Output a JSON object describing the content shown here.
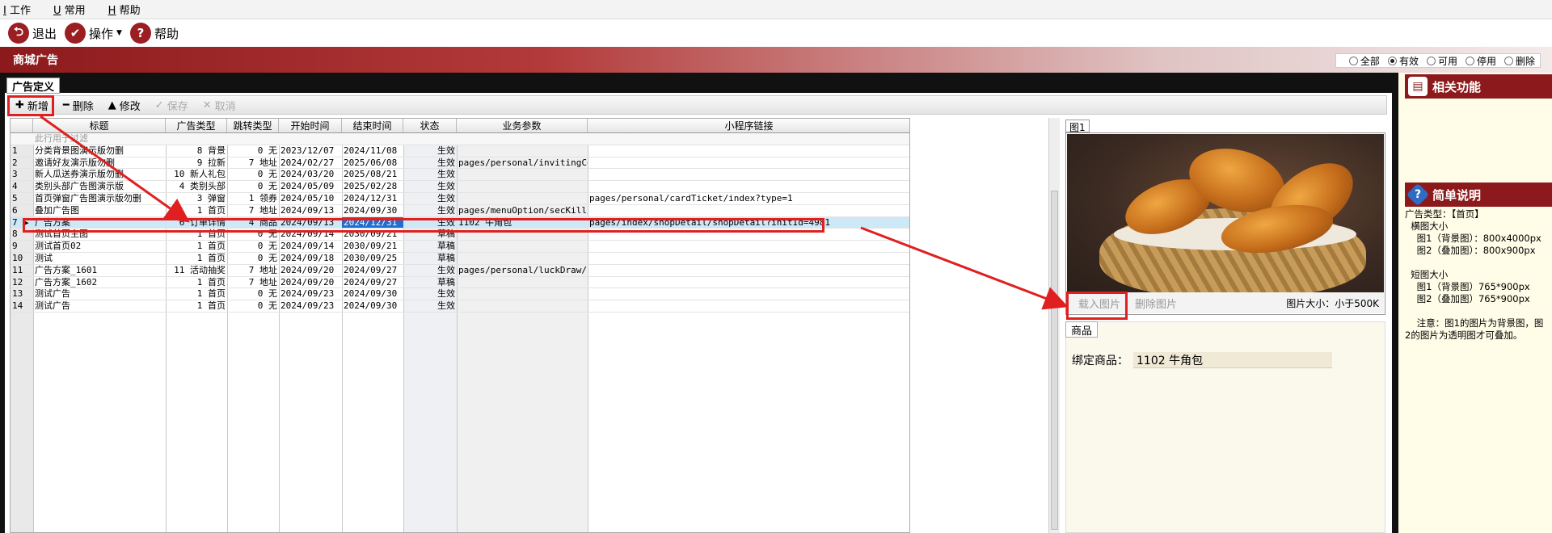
{
  "menu": {
    "items": [
      "工作",
      "常用",
      "帮助"
    ]
  },
  "toolbar": {
    "exit": "退出",
    "ops": "操作",
    "help": "帮助"
  },
  "page_title": "商城广告",
  "filter": {
    "options": [
      "全部",
      "有效",
      "可用",
      "停用",
      "删除"
    ],
    "selected": "有效"
  },
  "tab": "广告定义",
  "actions": {
    "add": "新增",
    "delete": "删除",
    "edit": "修改",
    "save": "保存",
    "cancel": "取消"
  },
  "grid": {
    "columns": [
      "标题",
      "广告类型",
      "跳转类型",
      "开始时间",
      "结束时间",
      "状态",
      "业务参数",
      "小程序链接"
    ],
    "filter_hint": "此行用于过滤",
    "rows": [
      {
        "no": "1",
        "title": "分类背景图演示版勿删",
        "adtype": "8 背景",
        "jump": "0 无",
        "start": "2023/12/07",
        "end": "2024/11/08",
        "status": "生效",
        "param": "",
        "link": ""
      },
      {
        "no": "2",
        "title": "邀请好友演示版勿删",
        "adtype": "9 拉新",
        "jump": "7 地址",
        "start": "2024/02/27",
        "end": "2025/06/08",
        "status": "生效",
        "param": "pages/personal/invitingCou",
        "link": ""
      },
      {
        "no": "3",
        "title": "新人瓜送券演示版勿删",
        "adtype": "10 新人礼包",
        "jump": "0 无",
        "start": "2024/03/20",
        "end": "2025/08/21",
        "status": "生效",
        "param": "",
        "link": ""
      },
      {
        "no": "4",
        "title": "类别头部广告图演示版",
        "adtype": "4 类别头部",
        "jump": "0 无",
        "start": "2024/05/09",
        "end": "2025/02/28",
        "status": "生效",
        "param": "",
        "link": ""
      },
      {
        "no": "5",
        "title": "首页弹窗广告图演示版勿删",
        "adtype": "3 弹窗",
        "jump": "1 领券",
        "start": "2024/05/10",
        "end": "2024/12/31",
        "status": "生效",
        "param": "",
        "link": "pages/personal/cardTicket/index?type=1"
      },
      {
        "no": "6",
        "title": "叠加广告图",
        "adtype": "1 首页",
        "jump": "7 地址",
        "start": "2024/09/13",
        "end": "2024/09/30",
        "status": "生效",
        "param": "pages/menuOption/secKill/i",
        "link": ""
      },
      {
        "no": "7",
        "title": "广告方案",
        "adtype": "6 订单详情",
        "jump": "4 商品",
        "start": "2024/09/13",
        "end": "2024/12/31",
        "status": "生效",
        "param": "1102 牛角包",
        "link": "pages/index/shopDetail/shopDetail?initId=4981"
      },
      {
        "no": "8",
        "title": "测试首页主图",
        "adtype": "1 首页",
        "jump": "0 无",
        "start": "2024/09/14",
        "end": "2030/09/21",
        "status": "草稿",
        "param": "",
        "link": ""
      },
      {
        "no": "9",
        "title": "测试首页02",
        "adtype": "1 首页",
        "jump": "0 无",
        "start": "2024/09/14",
        "end": "2030/09/21",
        "status": "草稿",
        "param": "",
        "link": ""
      },
      {
        "no": "10",
        "title": "测试",
        "adtype": "1 首页",
        "jump": "0 无",
        "start": "2024/09/18",
        "end": "2030/09/25",
        "status": "草稿",
        "param": "",
        "link": ""
      },
      {
        "no": "11",
        "title": "广告方案_1601",
        "adtype": "11 活动抽奖",
        "jump": "7 地址",
        "start": "2024/09/20",
        "end": "2024/09/27",
        "status": "生效",
        "param": "pages/personal/luckDraw/in",
        "link": ""
      },
      {
        "no": "12",
        "title": "广告方案_1602",
        "adtype": "1 首页",
        "jump": "7 地址",
        "start": "2024/09/20",
        "end": "2024/09/27",
        "status": "草稿",
        "param": "",
        "link": ""
      },
      {
        "no": "13",
        "title": "测试广告",
        "adtype": "1 首页",
        "jump": "0 无",
        "start": "2024/09/23",
        "end": "2024/09/30",
        "status": "生效",
        "param": "",
        "link": ""
      },
      {
        "no": "14",
        "title": "测试广告",
        "adtype": "1 首页",
        "jump": "0 无",
        "start": "2024/09/23",
        "end": "2024/09/30",
        "status": "生效",
        "param": "",
        "link": ""
      }
    ]
  },
  "image_panel": {
    "tab": "图1",
    "load": "载入图片",
    "remove": "删除图片",
    "size_note": "图片大小：小于500K"
  },
  "goods": {
    "tab": "商品",
    "bind_label": "绑定商品：",
    "bind_value": "1102 牛角包"
  },
  "sidebar": {
    "related": "相关功能",
    "brief": "简单说明",
    "desc": [
      "广告类型：【首页】",
      "  横图大小",
      "    图1（背景图）：800x4000px",
      "    图2（叠加图）：800x900px",
      "",
      "  短图大小",
      "    图1（背景图）765*900px",
      "    图2（叠加图）765*900px",
      "",
      "    注意：图1的图片为背景图，图",
      "2的图片为透明图才可叠加。"
    ]
  },
  "colors": {
    "brand": "#8c1a1c",
    "highlight_row": "#cde8f7",
    "annotation": "#e02020"
  }
}
